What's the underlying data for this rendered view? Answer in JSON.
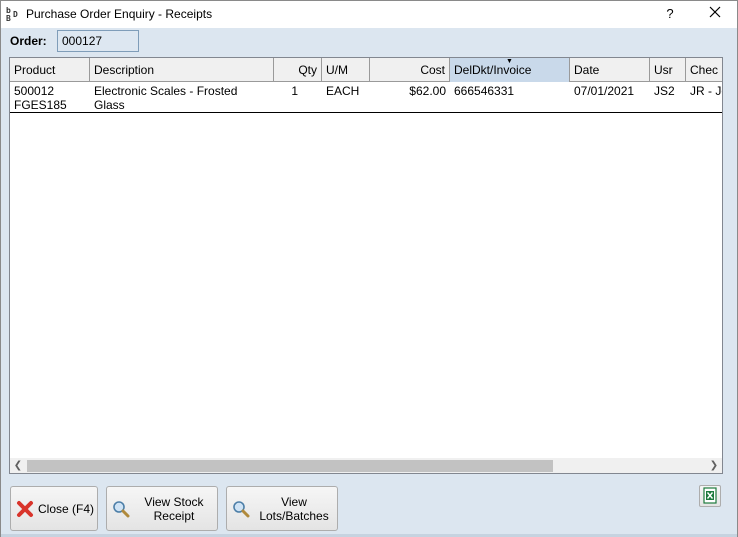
{
  "window": {
    "title": "Purchase Order Enquiry - Receipts",
    "help_label": "?",
    "close_label": "✕"
  },
  "order": {
    "label": "Order:",
    "value": "000127"
  },
  "grid": {
    "columns": [
      {
        "label": "Product"
      },
      {
        "label": "Description"
      },
      {
        "label": "Qty"
      },
      {
        "label": "U/M"
      },
      {
        "label": "Cost"
      },
      {
        "label": "DelDkt/Invoice",
        "sorted": true
      },
      {
        "label": "Date"
      },
      {
        "label": "Usr"
      },
      {
        "label": "Chec"
      }
    ],
    "rows": [
      {
        "product_line1": "500012",
        "product_line2": "FGES185",
        "description_line1": "Electronic Scales - Frosted",
        "description_line2": "Glass",
        "qty": "1",
        "um": "EACH",
        "cost": "$62.00",
        "deldkt": "666546331",
        "date": "07/01/2021",
        "usr": "JS2",
        "check": "JR - Jo"
      }
    ]
  },
  "buttons": {
    "close_label": "Close (F4)",
    "view_stock_receipt_label": "View Stock\nReceipt",
    "view_lots_label": "View\nLots/Batches"
  },
  "icons": {
    "app": "bdb-logo-icon",
    "close": "red-x-icon",
    "magnifier": "magnifier-icon",
    "excel": "excel-export-icon"
  },
  "colors": {
    "window_bg": "#dce6f0",
    "sorted_header": "#c9d9ea",
    "close_red": "#d9342b",
    "excel_green": "#1d7a3d"
  }
}
